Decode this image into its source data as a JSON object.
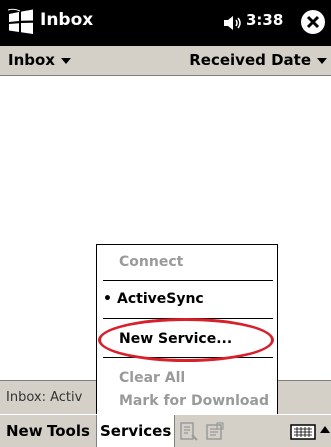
{
  "titlebar": {
    "app_title": "Inbox",
    "time": "3:38",
    "start_icon": "windows-flag-icon",
    "volume_icon": "speaker-icon",
    "close_icon": "close-icon",
    "background": "#000000"
  },
  "filterbar": {
    "folder": "Inbox",
    "sort": "Received Date"
  },
  "statusbar": {
    "text": "Inbox: Activ"
  },
  "menubar": {
    "new_label": "New",
    "tools_label": "Tools",
    "services_label": "Services",
    "icons": [
      "send-receive-icon",
      "folder-list-icon",
      "keyboard-icon",
      "up-arrow-icon"
    ]
  },
  "services_menu": {
    "connect": "Connect",
    "activesync": "ActiveSync",
    "activesync_bullet": "•",
    "new_service": "New Service...",
    "clear_all": "Clear All",
    "mark_for_download": "Mark for Download"
  },
  "colors": {
    "highlight": "#d8202a",
    "bar_gray": "#d4d0c8",
    "disabled_text": "#9a9a9a"
  }
}
